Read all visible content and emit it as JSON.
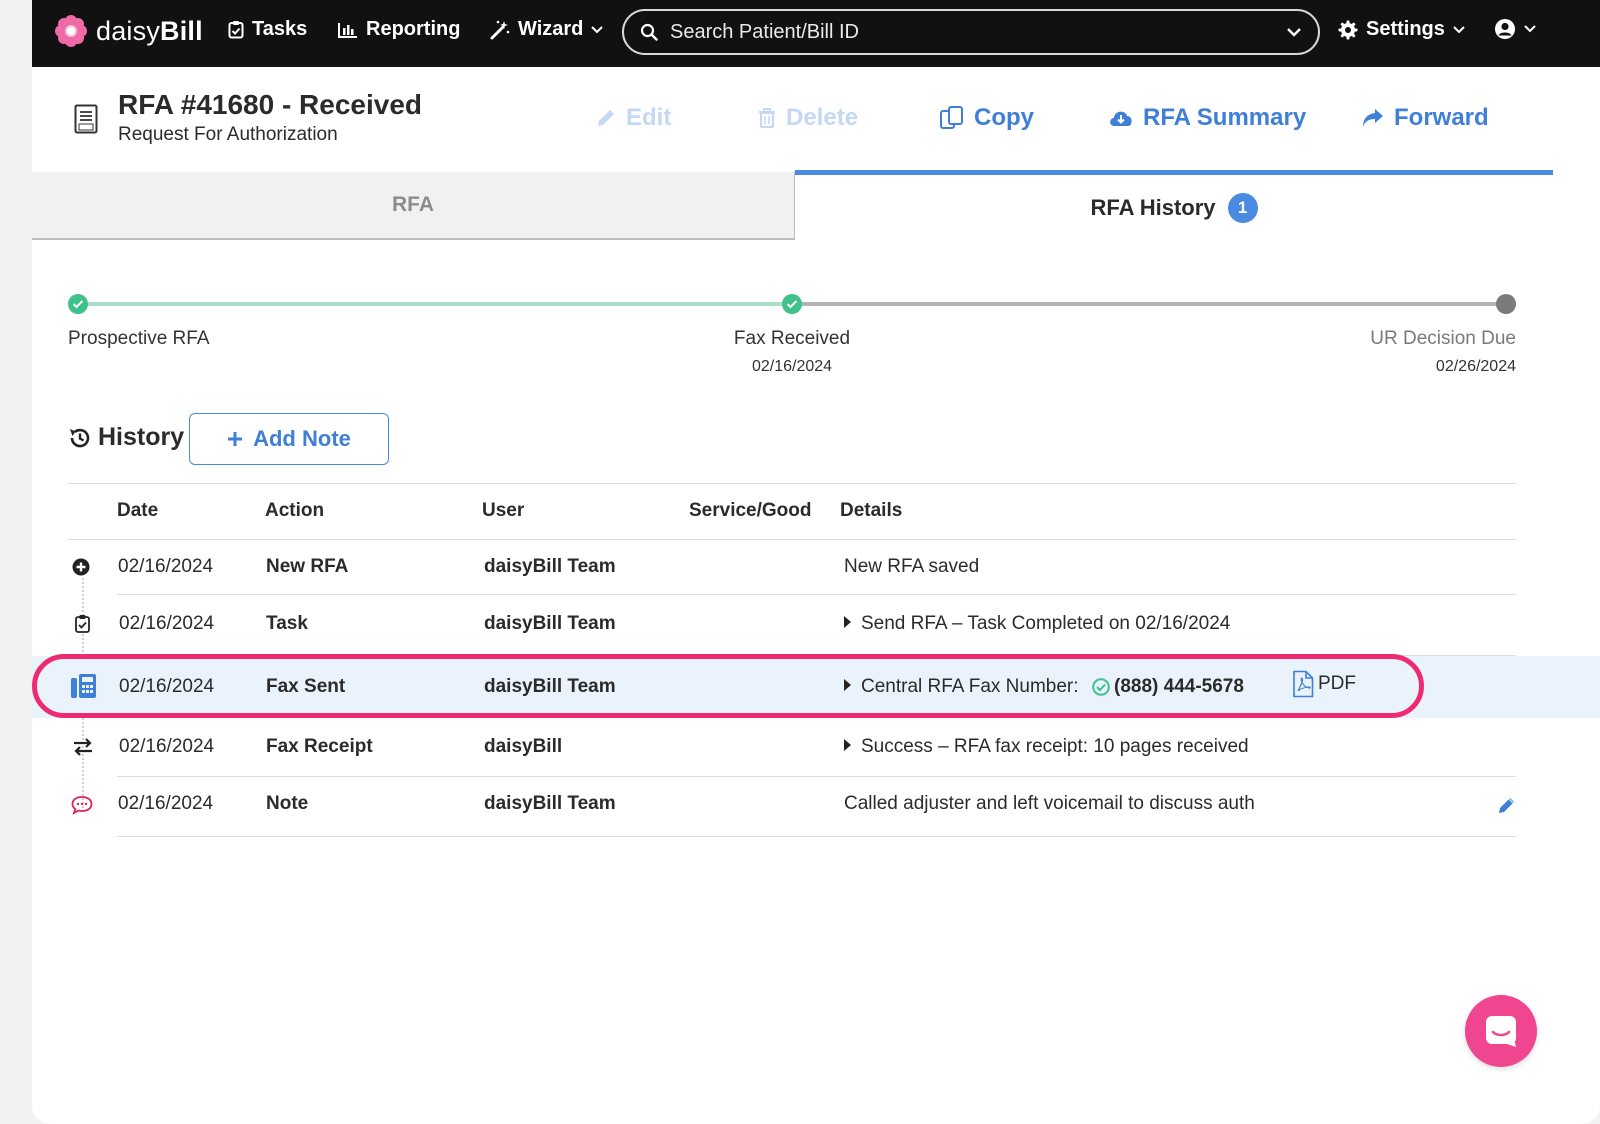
{
  "nav": {
    "logo_text_light": "daisy",
    "logo_text_bold": "Bill",
    "tasks": "Tasks",
    "reporting": "Reporting",
    "wizard": "Wizard",
    "search_placeholder": "Search Patient/Bill ID",
    "settings": "Settings"
  },
  "header": {
    "title": "RFA #41680 - Received",
    "subtitle": "Request For Authorization",
    "edit": "Edit",
    "delete": "Delete",
    "copy": "Copy",
    "summary": "RFA Summary",
    "forward": "Forward"
  },
  "tabs": {
    "rfa": "RFA",
    "history": "RFA History",
    "history_count": "1"
  },
  "timeline": {
    "steps": [
      {
        "label": "Prospective RFA",
        "date": "",
        "status": "complete"
      },
      {
        "label": "Fax Received",
        "date": "02/16/2024",
        "status": "complete"
      },
      {
        "label": "UR Decision Due",
        "date": "02/26/2024",
        "status": "pending"
      }
    ]
  },
  "history": {
    "title": "History",
    "add_note": "Add Note",
    "columns": [
      "Date",
      "Action",
      "User",
      "Service/Good",
      "Details"
    ],
    "rows": [
      {
        "icon": "plus-circle-icon",
        "date": "02/16/2024",
        "action": "New RFA",
        "user": "daisyBill Team",
        "service": "",
        "details": "New RFA saved"
      },
      {
        "icon": "task-icon",
        "date": "02/16/2024",
        "action": "Task",
        "user": "daisyBill Team",
        "service": "",
        "details": "Send RFA – Task Completed on 02/16/2024"
      },
      {
        "icon": "fax-icon",
        "date": "02/16/2024",
        "action": "Fax Sent",
        "user": "daisyBill Team",
        "service": "",
        "details_prefix": "Central RFA Fax Number:",
        "fax_number": "(888) 444-5678",
        "attachment": "PDF"
      },
      {
        "icon": "exchange-icon",
        "date": "02/16/2024",
        "action": "Fax Receipt",
        "user": "daisyBill",
        "service": "",
        "details": "Success – RFA fax receipt: 10 pages received"
      },
      {
        "icon": "comment-icon",
        "date": "02/16/2024",
        "action": "Note",
        "user": "daisyBill Team",
        "service": "",
        "details": "Called adjuster and left voicemail to discuss auth"
      }
    ]
  },
  "colors": {
    "nav_bg": "#111111",
    "accent_blue": "#4a8ae0",
    "success_green": "#3ec28a",
    "highlight_pink": "#ee2b72",
    "chat_pink": "#f0458f",
    "row_highlight": "#eaf2fc"
  }
}
